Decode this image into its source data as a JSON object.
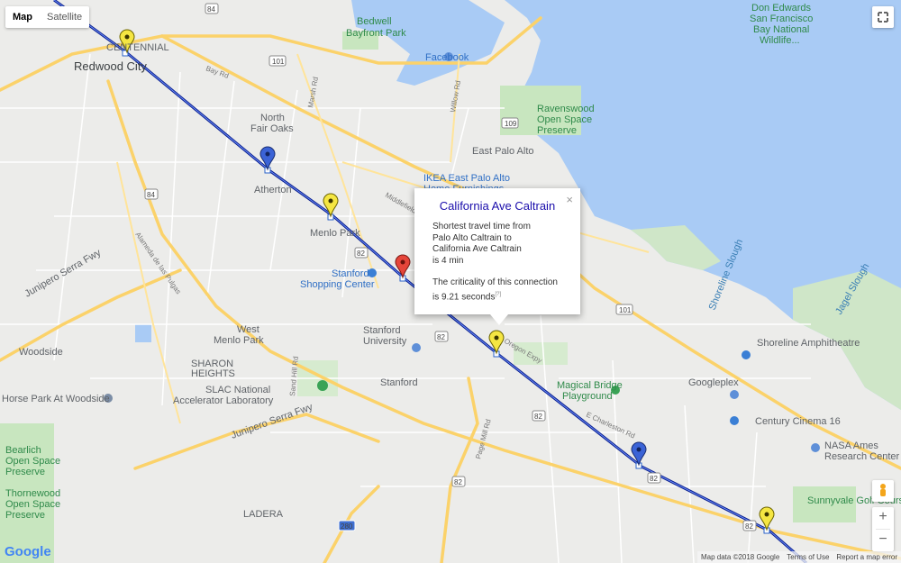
{
  "map_controls": {
    "map_label": "Map",
    "satellite_label": "Satellite",
    "zoom_in": "+",
    "zoom_out": "−"
  },
  "logo": "Google",
  "footer": {
    "attribution": "Map data ©2018 Google",
    "terms": "Terms of Use",
    "report": "Report a map error"
  },
  "info_window": {
    "title": "California Ave Caltrain",
    "close": "×",
    "line1": "Shortest travel time from",
    "line2": "Palo Alto Caltrain to",
    "line3": "California Ave Caltrain",
    "line4": "is 4 min",
    "line5": "The criticality of this connection",
    "line6": "is 9.21 seconds",
    "footnote": "[?]"
  },
  "labels": {
    "redwood_city": "Redwood City",
    "centennial": "CENTENNIAL",
    "bedwell1": "Bedwell",
    "bedwell2": "Bayfront Park",
    "facebook": "Facebook",
    "don1": "Don Edwards",
    "don2": "San Francisco",
    "don3": "Bay National",
    "don4": "Wildlife...",
    "north_fair_oaks1": "North",
    "north_fair_oaks2": "Fair Oaks",
    "ravenswood1": "Ravenswood",
    "ravenswood2": "Open Space",
    "ravenswood3": "Preserve",
    "east_palo_alto": "East Palo Alto",
    "ikea1": "IKEA East Palo Alto",
    "ikea2": "Home Furnishings",
    "atherton": "Atherton",
    "menlo_park": "Menlo Park",
    "stanford_sc1": "Stanford",
    "stanford_sc2": "Shopping Center",
    "stanford_univ1": "Stanford",
    "stanford_univ2": "University",
    "west_menlo1": "West",
    "west_menlo2": "Menlo Park",
    "woodside": "Woodside",
    "sharon1": "SHARON",
    "sharon2": "HEIGHTS",
    "slac1": "SLAC National",
    "slac2": "Accelerator Laboratory",
    "stanford": "Stanford",
    "horse_park": "Horse Park At Woodside",
    "bear1": "Bearlich",
    "bear2": "Open Space",
    "bear3": "Preserve",
    "thornewood1": "Thornewood",
    "thornewood2": "Open Space",
    "thornewood3": "Preserve",
    "ladera": "LADERA",
    "shoreline": "Shoreline Amphitheatre",
    "magical1": "Magical Bridge",
    "magical2": "Playground",
    "googleplex": "Googleplex",
    "century": "Century Cinema 16",
    "nasa1": "NASA Ames",
    "nasa2": "Research Center",
    "sunnyvale": "Sunnyvale Golf Course",
    "shoreline_slough": "Shoreline Slough",
    "jagel_slough": "Jagel Slough",
    "junipero1": "Junipero Serra Fwy",
    "junipero2": "Junipero Serra Fwy",
    "willow_rd": "Willow Rd",
    "page_mill": "Page Mill Rd",
    "el_camino": "E Charleston Rd",
    "middlefield": "Middlefield Rd",
    "sand_hill": "Sand Hill Rd",
    "alameda": "Alameda de las Pulgas",
    "marsh_rd": "Marsh Rd",
    "bay_rd": "Bay Rd",
    "oregon_expy": "Oregon Expy"
  },
  "shields": {
    "s101a": "101",
    "s101b": "101",
    "s109": "109",
    "s84": "84",
    "s82a": "82",
    "s82b": "82",
    "s82c": "82",
    "s82d": "82",
    "s82e": "82",
    "s82f": "82",
    "s280": "280",
    "s84b": "84"
  },
  "colors": {
    "rail": "#0a1f8f",
    "marker_yellow": "#f5e642",
    "marker_blue": "#3b63d6",
    "marker_red": "#e5453a",
    "water": "#a9cbf5",
    "park": "#c8e6bf",
    "highway": "#fbd26a"
  },
  "markers": [
    {
      "name": "yellow-marker",
      "color": "yellow"
    },
    {
      "name": "blue-marker",
      "color": "blue"
    },
    {
      "name": "yellow-marker",
      "color": "yellow"
    },
    {
      "name": "red-marker",
      "color": "red"
    },
    {
      "name": "yellow-marker",
      "color": "yellow"
    },
    {
      "name": "blue-marker",
      "color": "blue"
    },
    {
      "name": "yellow-marker",
      "color": "yellow"
    }
  ]
}
